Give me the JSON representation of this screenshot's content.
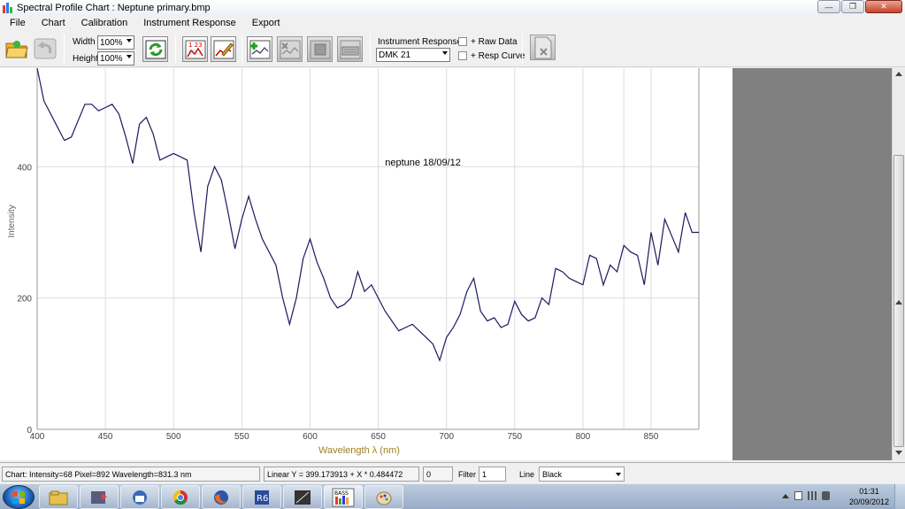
{
  "window": {
    "title": "Spectral Profile Chart : Neptune primary.bmp",
    "controls": {
      "minimize": "—",
      "maximize": "❐",
      "close": "✕"
    }
  },
  "menu": [
    "File",
    "Chart",
    "Calibration",
    "Instrument Response",
    "Export"
  ],
  "toolbar": {
    "width_label": "Width",
    "width_value": "100%",
    "height_label": "Height",
    "height_value": "100%",
    "instrument_response_label": "Instrument  Response",
    "instrument_response_value": "DMK 21",
    "raw_data_label": "+ Raw Data",
    "resp_curve_label": "+ Resp Curve",
    "icons": {
      "open": "open-folder-icon",
      "undo": "undo-icon",
      "refresh": "refresh-icon",
      "calibrate_table": "calibration-table-icon",
      "edit_chart": "edit-chart-icon",
      "add_line": "add-line-icon",
      "remove_line": "remove-line-icon",
      "crop": "crop-icon",
      "keyboard": "keyboard-icon",
      "close_doc": "close-document-icon"
    }
  },
  "chart_data": {
    "type": "line",
    "annotation": "neptune 18/09/12",
    "xlabel": "Wavelength λ (nm)",
    "ylabel": "Intensity",
    "xlim": [
      400,
      885
    ],
    "ylim": [
      0,
      550
    ],
    "xticks": [
      400,
      450,
      500,
      550,
      600,
      650,
      700,
      750,
      800,
      850
    ],
    "yticks": [
      0,
      200,
      400
    ],
    "grid": true,
    "line_color": "#1a1a5e",
    "x": [
      400,
      405,
      410,
      415,
      420,
      425,
      430,
      435,
      440,
      445,
      450,
      455,
      460,
      465,
      470,
      475,
      480,
      485,
      490,
      495,
      500,
      505,
      510,
      515,
      520,
      525,
      530,
      535,
      540,
      545,
      550,
      555,
      560,
      565,
      570,
      575,
      580,
      585,
      590,
      595,
      600,
      605,
      610,
      615,
      620,
      625,
      630,
      635,
      640,
      645,
      650,
      655,
      660,
      665,
      670,
      675,
      680,
      685,
      690,
      695,
      700,
      705,
      710,
      715,
      720,
      725,
      730,
      735,
      740,
      745,
      750,
      755,
      760,
      765,
      770,
      775,
      780,
      785,
      790,
      795,
      800,
      805,
      810,
      815,
      820,
      825,
      830,
      835,
      840,
      845,
      850,
      855,
      860,
      865,
      870,
      875,
      880,
      885
    ],
    "y": [
      550,
      500,
      480,
      460,
      440,
      445,
      470,
      495,
      495,
      485,
      490,
      495,
      480,
      445,
      405,
      465,
      475,
      450,
      410,
      415,
      420,
      415,
      410,
      330,
      270,
      370,
      400,
      380,
      330,
      275,
      320,
      355,
      320,
      290,
      270,
      250,
      200,
      160,
      200,
      260,
      290,
      255,
      230,
      200,
      185,
      190,
      200,
      240,
      210,
      220,
      200,
      180,
      165,
      150,
      155,
      160,
      150,
      140,
      130,
      105,
      140,
      155,
      175,
      210,
      230,
      180,
      165,
      170,
      155,
      160,
      195,
      175,
      165,
      170,
      200,
      190,
      245,
      240,
      230,
      225,
      220,
      265,
      260,
      220,
      250,
      240,
      280,
      270,
      265,
      220,
      300,
      250,
      320,
      295,
      270,
      330,
      300,
      300
    ]
  },
  "statusbar": {
    "readout": "Chart: Intensity=68  Pixel=892  Wavelength=831.3 nm",
    "fit": "Linear Y = 399.173913  +  X * 0.484472",
    "zero_box": "0",
    "filter_label": "Filter",
    "filter_value": "1",
    "line_label": "Line",
    "line_value": "Black"
  },
  "taskbar": {
    "apps": [
      "explorer-icon",
      "media-player-icon",
      "thunderbird-icon",
      "chrome-icon",
      "firefox-icon",
      "registax-icon",
      "image-viewer-icon",
      "bass-icon",
      "paint-icon"
    ],
    "time": "01:31",
    "date": "20/09/2012"
  }
}
